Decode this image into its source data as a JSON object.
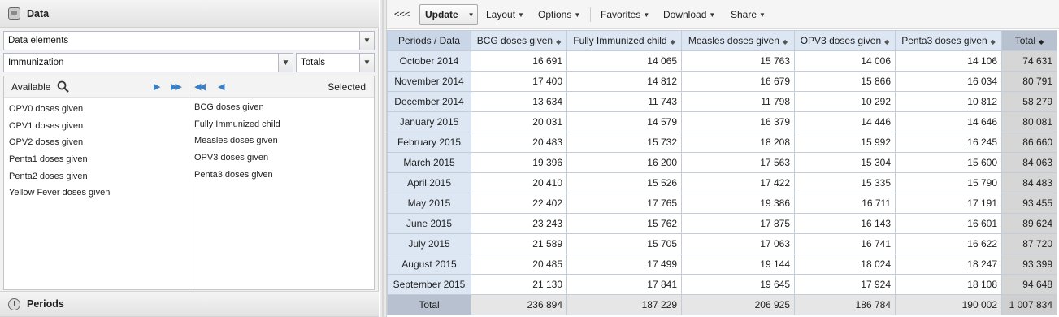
{
  "left_panel": {
    "data_section_title": "Data",
    "data_elements_select": "Data elements",
    "group_select": "Immunization",
    "detail_select": "Totals",
    "available_label": "Available",
    "selected_label": "Selected",
    "available_items": [
      "OPV0 doses given",
      "OPV1 doses given",
      "OPV2 doses given",
      "Penta1 doses given",
      "Penta2 doses given",
      "Yellow Fever doses given"
    ],
    "selected_items": [
      "BCG doses given",
      "Fully Immunized child",
      "Measles doses given",
      "OPV3 doses given",
      "Penta3 doses given"
    ],
    "periods_section_title": "Periods"
  },
  "toolbar": {
    "collapse": "<<<",
    "update": "Update",
    "layout": "Layout",
    "options": "Options",
    "favorites": "Favorites",
    "download": "Download",
    "share": "Share"
  },
  "table": {
    "corner": "Periods / Data",
    "columns": [
      "BCG doses given",
      "Fully Immunized child",
      "Measles doses given",
      "OPV3 doses given",
      "Penta3 doses given"
    ],
    "total_label": "Total",
    "rows": [
      {
        "period": "October 2014",
        "values": [
          "16 691",
          "14 065",
          "15 763",
          "14 006",
          "14 106"
        ],
        "total": "74 631"
      },
      {
        "period": "November 2014",
        "values": [
          "17 400",
          "14 812",
          "16 679",
          "15 866",
          "16 034"
        ],
        "total": "80 791"
      },
      {
        "period": "December 2014",
        "values": [
          "13 634",
          "11 743",
          "11 798",
          "10 292",
          "10 812"
        ],
        "total": "58 279"
      },
      {
        "period": "January 2015",
        "values": [
          "20 031",
          "14 579",
          "16 379",
          "14 446",
          "14 646"
        ],
        "total": "80 081"
      },
      {
        "period": "February 2015",
        "values": [
          "20 483",
          "15 732",
          "18 208",
          "15 992",
          "16 245"
        ],
        "total": "86 660"
      },
      {
        "period": "March 2015",
        "values": [
          "19 396",
          "16 200",
          "17 563",
          "15 304",
          "15 600"
        ],
        "total": "84 063"
      },
      {
        "period": "April 2015",
        "values": [
          "20 410",
          "15 526",
          "17 422",
          "15 335",
          "15 790"
        ],
        "total": "84 483"
      },
      {
        "period": "May 2015",
        "values": [
          "22 402",
          "17 765",
          "19 386",
          "16 711",
          "17 191"
        ],
        "total": "93 455"
      },
      {
        "period": "June 2015",
        "values": [
          "23 243",
          "15 762",
          "17 875",
          "16 143",
          "16 601"
        ],
        "total": "89 624"
      },
      {
        "period": "July 2015",
        "values": [
          "21 589",
          "15 705",
          "17 063",
          "16 741",
          "16 622"
        ],
        "total": "87 720"
      },
      {
        "period": "August 2015",
        "values": [
          "20 485",
          "17 499",
          "19 144",
          "18 024",
          "18 247"
        ],
        "total": "93 399"
      },
      {
        "period": "September 2015",
        "values": [
          "21 130",
          "17 841",
          "19 645",
          "17 924",
          "18 108"
        ],
        "total": "94 648"
      }
    ],
    "totals_row": {
      "period": "Total",
      "values": [
        "236 894",
        "187 229",
        "206 925",
        "186 784",
        "190 002"
      ],
      "total": "1 007 834"
    }
  }
}
